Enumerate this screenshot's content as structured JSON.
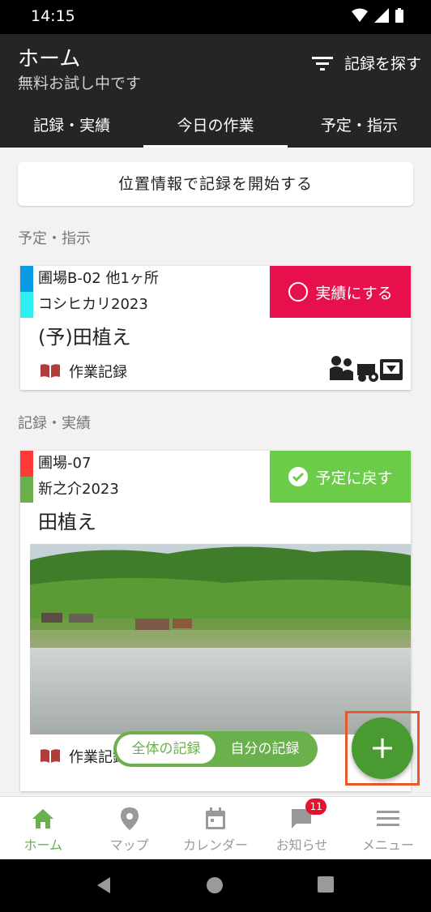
{
  "status_bar": {
    "time": "14:15"
  },
  "header": {
    "title": "ホーム",
    "subtitle": "無料お試し中です",
    "search_label": "記録を探す"
  },
  "tabs": [
    {
      "label": "記録・実績"
    },
    {
      "label": "今日の作業"
    },
    {
      "label": "予定・指示"
    }
  ],
  "start_button": "位置情報で記録を開始する",
  "sections": {
    "plans": "予定・指示",
    "records": "記録・実績"
  },
  "card1": {
    "field": "圃場B-02 他1ヶ所",
    "crop": "コシヒカリ2023",
    "title": "(予)田植え",
    "action": "実績にする",
    "link": "作業記録",
    "colors": {
      "field": "#0a9be6",
      "crop": "#2ff0f0",
      "action": "#e8104c"
    }
  },
  "card2": {
    "field": "圃場-07",
    "crop": "新之介2023",
    "title": "田植え",
    "action": "予定に戻す",
    "link": "作業記録",
    "colors": {
      "field": "#ff3838",
      "crop": "#6ab04c",
      "action": "#6ccc4a"
    }
  },
  "toggle": {
    "all": "全体の記録",
    "mine": "自分の記録"
  },
  "fab": "+",
  "bottom_nav": [
    {
      "label": "ホーム",
      "icon": "home-icon"
    },
    {
      "label": "マップ",
      "icon": "map-pin-icon"
    },
    {
      "label": "カレンダー",
      "icon": "calendar-icon"
    },
    {
      "label": "お知らせ",
      "icon": "chat-icon",
      "badge": "11"
    },
    {
      "label": "メニュー",
      "icon": "menu-icon"
    }
  ]
}
